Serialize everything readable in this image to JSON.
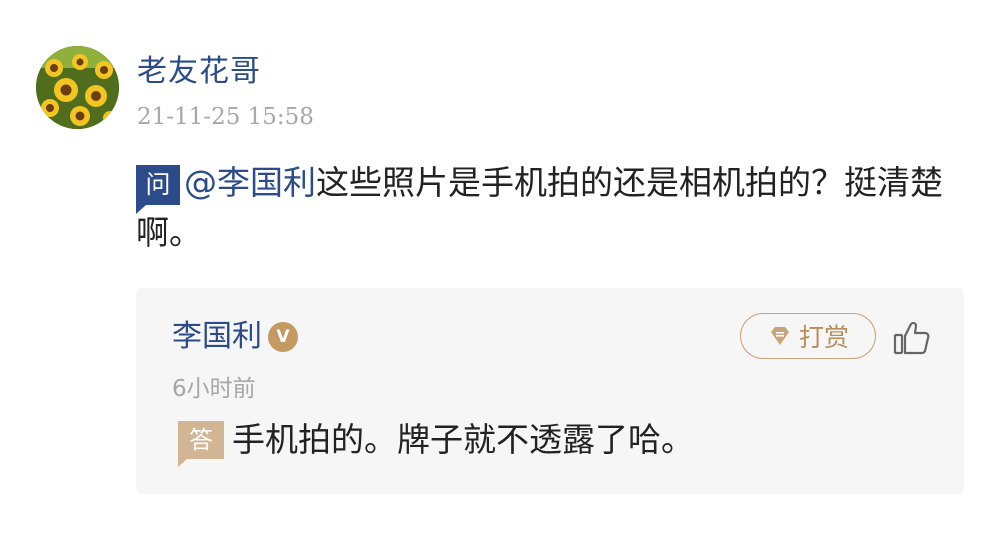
{
  "post": {
    "avatar_icon": "sunflower-avatar",
    "username": "老友花哥",
    "timestamp": "21-11-25 15:58",
    "question_tag": "问",
    "mention": "@李国利",
    "question_text": "这些照片是手机拍的还是相机拍的？挺清楚啊。"
  },
  "answer": {
    "author": "李国利",
    "verified_badge": "V",
    "tip_label": "打赏",
    "tip_icon": "diamond-coin-icon",
    "like_icon": "thumbs-up-icon",
    "time": "6小时前",
    "answer_tag": "答",
    "text": "手机拍的。牌子就不透露了哈。"
  },
  "colors": {
    "link_blue": "#2b4b8a",
    "gold": "#c49a62",
    "card_bg": "#f6f6f6",
    "muted": "#a7a7a7"
  }
}
